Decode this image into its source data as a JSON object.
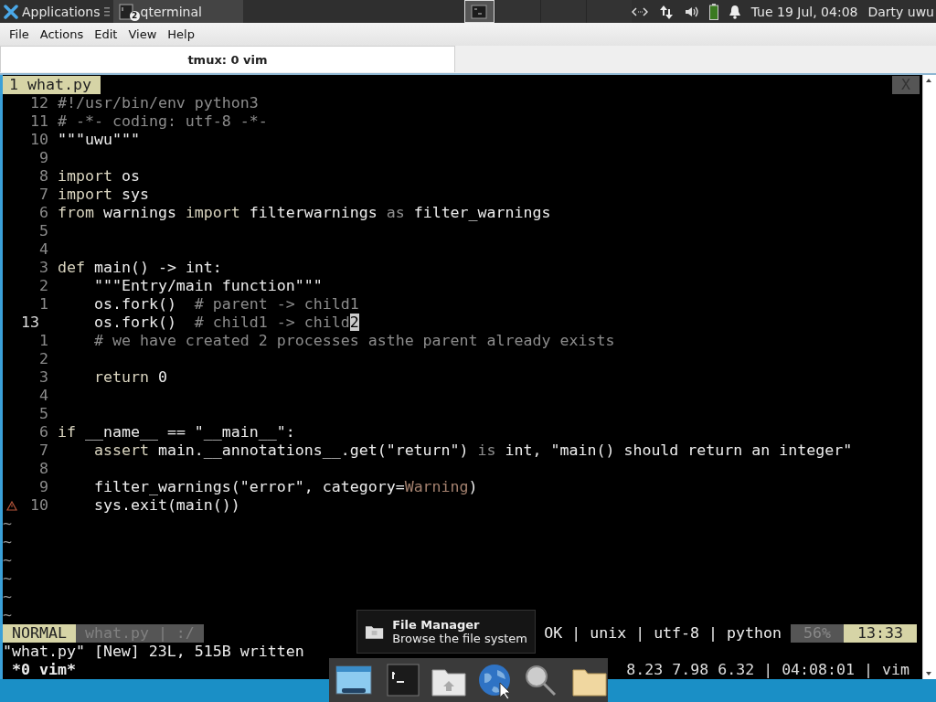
{
  "top_panel": {
    "apps_label": "Applications",
    "tasks": [
      {
        "label": "qterminal",
        "badge": "2",
        "selected": true
      }
    ],
    "workspaces": [
      {
        "selected": true
      },
      {
        "selected": false
      },
      {
        "selected": false
      },
      {
        "selected": false
      }
    ],
    "clock": "Tue 19 Jul, 04:08",
    "user": "Darty uwu"
  },
  "menu_bar": [
    "File",
    "Actions",
    "Edit",
    "View",
    "Help"
  ],
  "tabs": [
    {
      "label": "tmux: 0 vim",
      "selected": true
    }
  ],
  "vim": {
    "buffer_tab": "1 what.py",
    "close_label": "X",
    "lines": [
      {
        "number": "12",
        "current": false,
        "warning": false,
        "segments": [
          {
            "text": "#!/usr/bin/env python3",
            "kind": "comment"
          }
        ]
      },
      {
        "number": "11",
        "current": false,
        "warning": false,
        "segments": [
          {
            "text": "# -*- coding: utf-8 -*-",
            "kind": "comment"
          }
        ]
      },
      {
        "number": "10",
        "current": false,
        "warning": false,
        "segments": [
          {
            "text": "\"\"\"uwu\"\"\"",
            "kind": "text"
          }
        ]
      },
      {
        "number": "9",
        "current": false,
        "warning": false
      },
      {
        "number": "8",
        "current": false,
        "warning": false,
        "segments": [
          {
            "text": "import",
            "kind": "keyword"
          },
          {
            "text": " os",
            "kind": "text"
          }
        ]
      },
      {
        "number": "7",
        "current": false,
        "warning": false,
        "segments": [
          {
            "text": "import",
            "kind": "keyword"
          },
          {
            "text": " sys",
            "kind": "text"
          }
        ]
      },
      {
        "number": "6",
        "current": false,
        "warning": false,
        "segments": [
          {
            "text": "from",
            "kind": "keyword"
          },
          {
            "text": " warnings ",
            "kind": "text"
          },
          {
            "text": "import",
            "kind": "keyword"
          },
          {
            "text": " filterwarnings ",
            "kind": "text"
          },
          {
            "text": "as",
            "kind": "operator"
          },
          {
            "text": " filter_warnings",
            "kind": "text"
          }
        ]
      },
      {
        "number": "5",
        "current": false,
        "warning": false
      },
      {
        "number": "4",
        "current": false,
        "warning": false
      },
      {
        "number": "3",
        "current": false,
        "warning": false,
        "segments": [
          {
            "text": "def",
            "kind": "keyword"
          },
          {
            "text": " main() -> int:",
            "kind": "text"
          }
        ]
      },
      {
        "number": "2",
        "current": false,
        "warning": false,
        "segments": [
          {
            "text": "    \"\"\"Entry/main function\"\"\"",
            "kind": "text"
          }
        ]
      },
      {
        "number": "1",
        "current": false,
        "warning": false,
        "segments": [
          {
            "text": "    os.fork()  ",
            "kind": "text"
          },
          {
            "text": "# parent -> child1",
            "kind": "comment"
          }
        ]
      },
      {
        "number": "13",
        "current": true,
        "warning": false,
        "segments": [
          {
            "text": "    os.fork()  ",
            "kind": "text"
          },
          {
            "text": "# child1 -> child",
            "kind": "comment"
          },
          {
            "text": "2",
            "kind": "cursor"
          }
        ]
      },
      {
        "number": "1",
        "current": false,
        "warning": false,
        "segments": [
          {
            "text": "    # we have created 2 processes asthe parent already exists",
            "kind": "comment"
          }
        ]
      },
      {
        "number": "2",
        "current": false,
        "warning": false
      },
      {
        "number": "3",
        "current": false,
        "warning": false,
        "segments": [
          {
            "text": "    return",
            "kind": "keyword"
          },
          {
            "text": " 0",
            "kind": "text"
          }
        ]
      },
      {
        "number": "4",
        "current": false,
        "warning": false
      },
      {
        "number": "5",
        "current": false,
        "warning": false
      },
      {
        "number": "6",
        "current": false,
        "warning": false,
        "segments": [
          {
            "text": "if",
            "kind": "keyword"
          },
          {
            "text": " __name__ == \"__main__\":",
            "kind": "text"
          }
        ]
      },
      {
        "number": "7",
        "current": false,
        "warning": false,
        "segments": [
          {
            "text": "    assert",
            "kind": "keyword"
          },
          {
            "text": " main.__annotations__.get(\"return\") ",
            "kind": "text"
          },
          {
            "text": "is",
            "kind": "operator"
          },
          {
            "text": " int, \"main() should return an integer\"",
            "kind": "text"
          }
        ]
      },
      {
        "number": "8",
        "current": false,
        "warning": false
      },
      {
        "number": "9",
        "current": false,
        "warning": false,
        "segments": [
          {
            "text": "    filter_warnings(\"error\", category=",
            "kind": "text"
          },
          {
            "text": "Warning",
            "kind": "builtin"
          },
          {
            "text": ")",
            "kind": "text"
          }
        ]
      },
      {
        "number": "10",
        "current": false,
        "warning": true,
        "segments": [
          {
            "text": "    sys.exit(main())",
            "kind": "text"
          }
        ]
      }
    ],
    "filler_lines": [
      "~",
      "~",
      "~",
      "~",
      "~",
      "~"
    ],
    "statusline": {
      "mode": "NORMAL",
      "file": "what.py | :/",
      "info": "OK | unix | utf-8 | python",
      "percent": "56%",
      "position": "13:33"
    },
    "command_line": "\"what.py\" [New] 23L, 515B written"
  },
  "tmux_status": {
    "windows": "*0 vim*",
    "right": "8.23 7.98 6.32 | 04:08:01 | vim"
  },
  "tooltip": {
    "title": "File Manager",
    "subtitle": "Browse the file system"
  },
  "dock": [
    {
      "kind": "window"
    },
    {
      "kind": "separator"
    },
    {
      "kind": "terminal"
    },
    {
      "kind": "home"
    },
    {
      "kind": "globe"
    },
    {
      "kind": "search"
    },
    {
      "kind": "separator"
    },
    {
      "kind": "folder"
    }
  ]
}
